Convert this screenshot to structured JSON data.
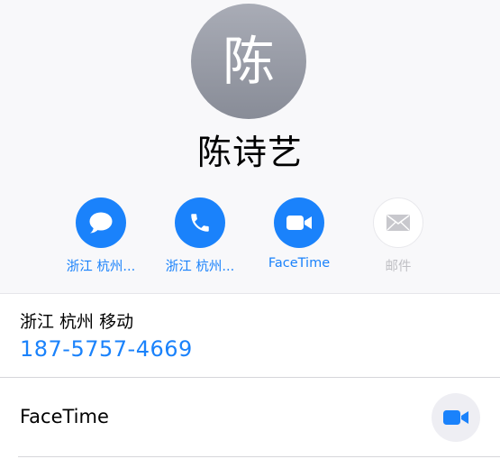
{
  "contact": {
    "avatar_initial": "陈",
    "name": "陈诗艺"
  },
  "actions": [
    {
      "label": "浙江 杭州...",
      "icon": "message-bubble-icon",
      "enabled": true
    },
    {
      "label": "浙江 杭州...",
      "icon": "phone-icon",
      "enabled": true
    },
    {
      "label": "FaceTime",
      "icon": "video-camera-icon",
      "enabled": true
    },
    {
      "label": "邮件",
      "icon": "mail-icon",
      "enabled": false
    }
  ],
  "phone_row": {
    "carrier": "浙江 杭州 移动",
    "number": "187-5757-4669"
  },
  "facetime_row": {
    "label": "FaceTime",
    "icon": "video-camera-icon"
  },
  "colors": {
    "accent": "#1a82fb",
    "disabled": "#bfbfc4",
    "avatar_gradient_top": "#a9acb6",
    "avatar_gradient_bottom": "#888c97"
  }
}
